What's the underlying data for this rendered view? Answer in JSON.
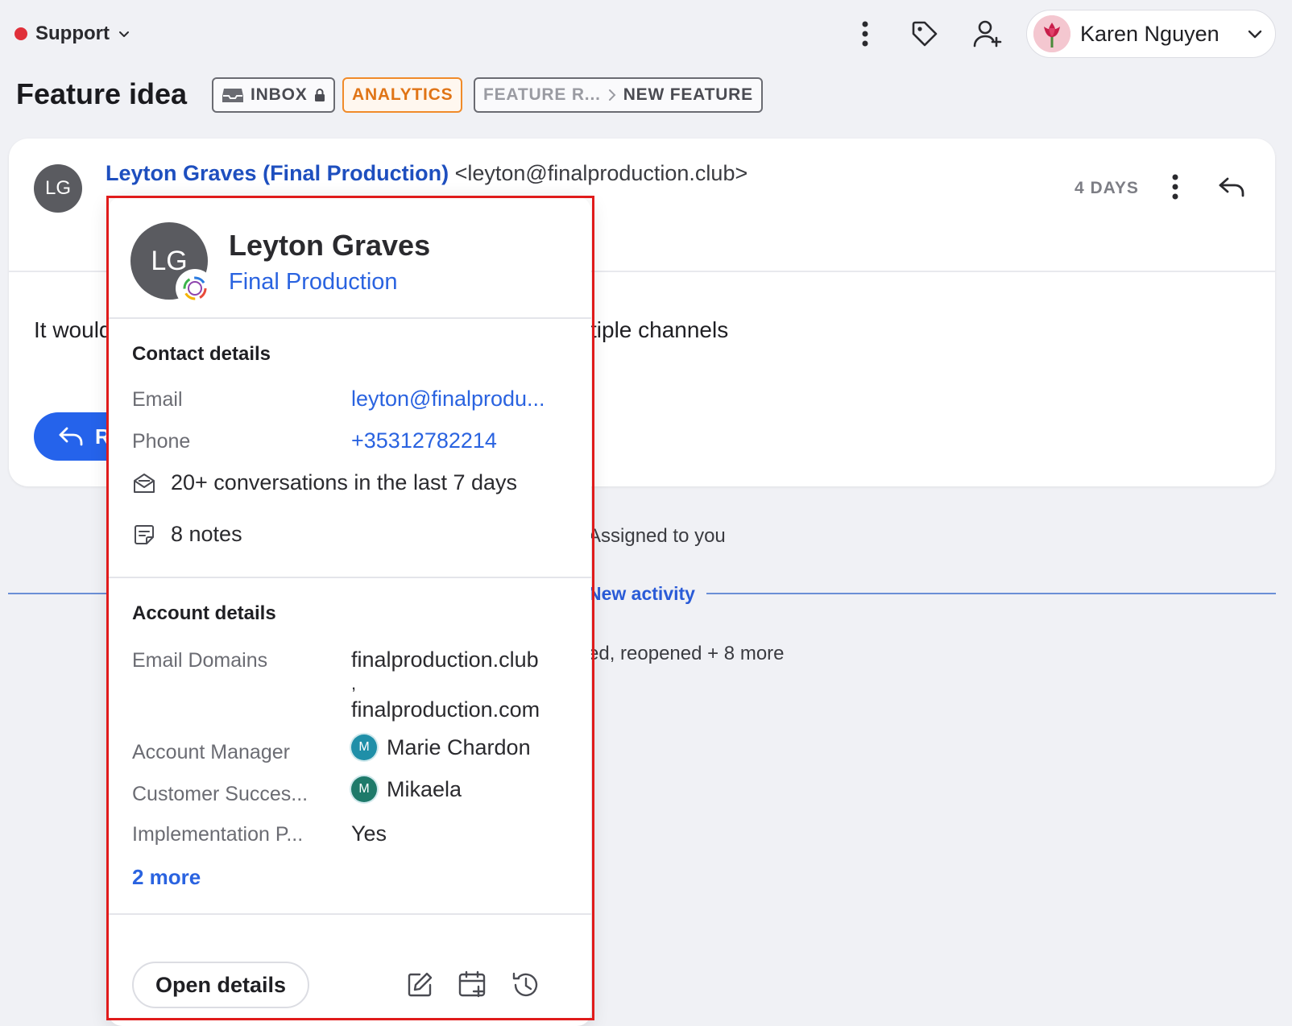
{
  "topbar": {
    "inbox_name": "Support",
    "inbox_status_color": "#e0303a",
    "icons": [
      "more-vertical-icon",
      "tag-icon",
      "assign-user-icon"
    ],
    "user": {
      "name": "Karen Nguyen",
      "avatar": "tulip-avatar"
    }
  },
  "conversation": {
    "title": "Feature idea",
    "tags": {
      "inbox": "INBOX",
      "analytics": "ANALYTICS",
      "feature_parent": "FEATURE R...",
      "feature_child": "NEW FEATURE"
    }
  },
  "message": {
    "avatar_initials": "LG",
    "sender_name": "Leyton Graves (Final Production)",
    "sender_email": "<leyton@finalproduction.club>",
    "time": "4 DAYS",
    "body_start": "It would",
    "body_end": "tiple channels",
    "reply_label": "R"
  },
  "timeline": {
    "assigned_text": "Assigned to you",
    "new_activity": "New activity",
    "events_text": "ed, reopened + 8 more"
  },
  "popover": {
    "initials": "LG",
    "name": "Leyton Graves",
    "company": "Final Production",
    "contact_section": "Contact details",
    "email_label": "Email",
    "email_value": "leyton@finalprodu...",
    "phone_label": "Phone",
    "phone_value": "+35312782214",
    "conversations_text": "20+ conversations in the last 7 days",
    "notes_text": "8 notes",
    "account_section": "Account details",
    "domains_label": "Email Domains",
    "domains_value_1": "finalproduction.club",
    "domains_sep": ",",
    "domains_value_2": "finalproduction.com",
    "manager_label": "Account Manager",
    "manager_initial": "M",
    "manager_name": "Marie Chardon",
    "manager_color": "#1f8fa8",
    "csm_label": "Customer Succes...",
    "csm_initial": "M",
    "csm_name": "Mikaela",
    "csm_color": "#1e7a6a",
    "impl_label": "Implementation P...",
    "impl_value": "Yes",
    "more_link": "2 more",
    "open_button": "Open details",
    "action_icons": [
      "edit-icon",
      "add-calendar-icon",
      "history-icon"
    ]
  },
  "colors": {
    "accent_blue": "#2563eb",
    "link_blue": "#2a63e0",
    "analytics_orange": "#e07416",
    "highlight_red": "#e01b1b"
  }
}
